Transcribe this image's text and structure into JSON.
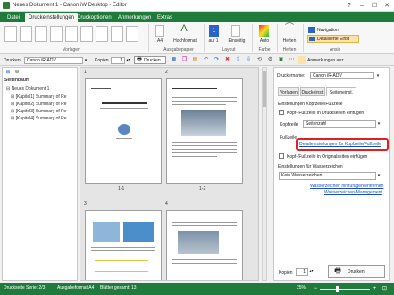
{
  "window": {
    "title": "Neues Dokument 1 - Canon iW Desktop - Editor",
    "help": "?",
    "minimize": "–",
    "maximize": "☐",
    "close": "✕"
  },
  "tabs": [
    "Datei",
    "Druckeinstellungen",
    "Druckoptionen",
    "Anmerkungen",
    "Extras"
  ],
  "ribbon": {
    "groups": {
      "vorlagen": "Vorlagen",
      "ausgabepapier": "Ausgabepapier",
      "layout": "Layout",
      "farbe": "Farbe",
      "heften": "Heften",
      "ansicht": "Ansic"
    },
    "buttons": {
      "a4": "A4",
      "hochformat": "Hochformat",
      "auf1": "auf 1",
      "one": "1",
      "einseitig": "Einseitig",
      "auto": "Auto",
      "heften": "Heften"
    },
    "navigation": "Navigation",
    "detailed": "Detaillierte Einst"
  },
  "toolbar": {
    "drucken_label": "Drucken",
    "printer": "Canon iR-ADV",
    "kopien_label": "Kopien",
    "kopien_value": "1",
    "drucken_btn": "Drucken",
    "anmerkungen": "Anmerkungen anz."
  },
  "left_pane": {
    "title": "Seitenbaum",
    "items": [
      "Neues Dokument 1",
      "[Kapitel1] Summary of Re",
      "[Kapitel2] Summary of Re",
      "[Kapitel3] Summary of Re",
      "[Kapitel4] Summary of Re"
    ]
  },
  "center": {
    "page_labels": [
      "1",
      "2",
      "3",
      "4"
    ],
    "spread_labels": [
      "1-1",
      "1-2"
    ]
  },
  "right_panel": {
    "druckername_label": "Druckername:",
    "druckername_value": "Canon iR-ADV",
    "tabs": [
      "Vorlagen",
      "Druckeinst.",
      "Seiteneinst."
    ],
    "heading": "Einstellungen Kopfzeile/Fußzeile",
    "chk_kopf": "Kopf-/Fußzeile in Druckseiten einfügen",
    "kopfzeile_label": "Kopfzeile",
    "kopfzeile_value": "Seitenzahl",
    "fusszeile_label": "Fußzeile",
    "detail_link": "Detaileinstellungen für Kopfzeile/Fußzeile",
    "chk_original": "Kopf-/Fußzeile in Originalseiten einfügen",
    "wasserzeichen_label": "Einstellungen für Wasserzeichen",
    "wasserzeichen_value": "Kein Wasserzeichen",
    "link_add": "Wasserzeichen hinzufügen/entfernen",
    "link_manage": "Wasserzeichen-Management",
    "kopien_label": "Kopien",
    "kopien_value": "1",
    "print_button": "Drucken"
  },
  "status": {
    "gesamt": "Druckseite Serie: 2/3",
    "format": "Ausgabeformat:A4",
    "blatter": "Blätter gesamt: 13",
    "zoom": "25%"
  },
  "colors": {
    "accent": "#1e7b3c",
    "highlight": "#e02020",
    "link": "#1a4fc4"
  }
}
